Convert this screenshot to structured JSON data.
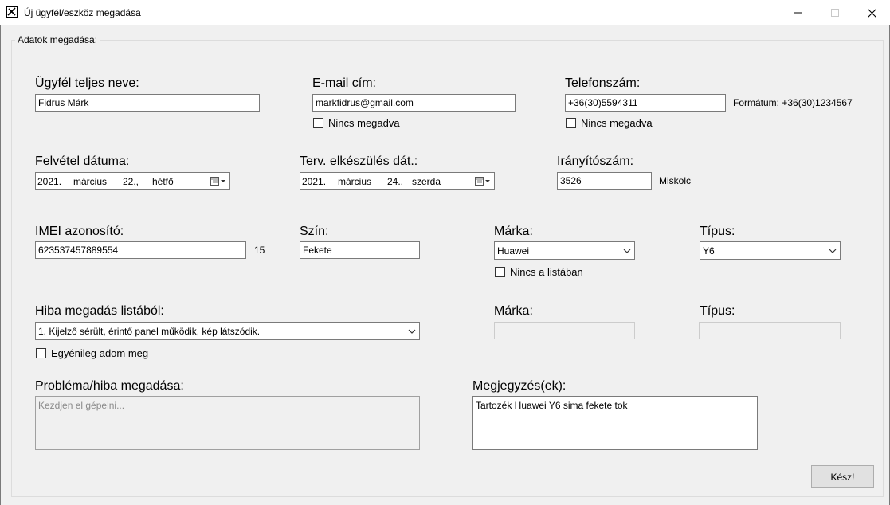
{
  "window": {
    "title": "Új ügyfél/eszköz megadása",
    "icon": "tools-icon"
  },
  "group": {
    "title": "Adatok megadása:"
  },
  "customer": {
    "label": "Ügyfél teljes neve:",
    "value": "Fidrus Márk"
  },
  "email": {
    "label": "E-mail cím:",
    "value": "markfidrus@gmail.com",
    "none_label": "Nincs megadva"
  },
  "phone": {
    "label": "Telefonszám:",
    "value": "+36(30)5594311",
    "none_label": "Nincs megadva",
    "format_hint": "Formátum: +36(30)1234567"
  },
  "intake_date": {
    "label": "Felvétel dátuma:",
    "year": "2021.",
    "month": "március",
    "day": "22.,",
    "weekday": "hétfő"
  },
  "planned_date": {
    "label": "Terv. elkészülés dát.:",
    "year": "2021.",
    "month": "március",
    "day": "24.,",
    "weekday": "szerda"
  },
  "postal": {
    "label": "Irányítószám:",
    "value": "3526",
    "city": "Miskolc"
  },
  "imei": {
    "label": "IMEI azonosító:",
    "value": "623537457889554",
    "length": "15"
  },
  "color": {
    "label": "Szín:",
    "value": "Fekete"
  },
  "brand": {
    "label": "Márka:",
    "value": "Huawei",
    "not_listed_label": "Nincs a listában"
  },
  "type": {
    "label": "Típus:",
    "value": "Y6"
  },
  "fault": {
    "label": "Hiba megadás listából:",
    "value": "1. Kijelző sérült, érintő panel működik, kép látszódik.",
    "custom_label": "Egyénileg adom meg"
  },
  "brand2": {
    "label": "Márka:",
    "value": ""
  },
  "type2": {
    "label": "Típus:",
    "value": ""
  },
  "problem": {
    "label": "Probléma/hiba megadása:",
    "placeholder": "Kezdjen el gépelni..."
  },
  "notes": {
    "label": "Megjegyzés(ek):",
    "value": "Tartozék Huawei Y6 sima fekete tok"
  },
  "actions": {
    "done_label": "Kész!"
  }
}
